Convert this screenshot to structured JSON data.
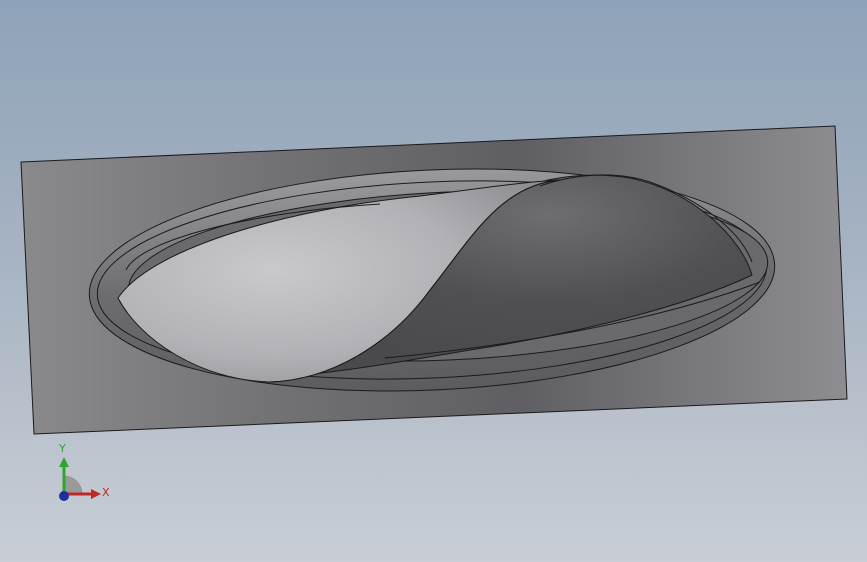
{
  "viewport": {
    "background_top": "#8ea2b9",
    "background_bottom": "#c9ced5"
  },
  "model": {
    "plate_color": "#7d7d80",
    "bump_light": "#c4c4c8",
    "bump_dark": "#4e4e52",
    "edge_color": "#1a1a1a"
  },
  "triad": {
    "x_label": "X",
    "y_label": "Y",
    "x_color": "#c0262a",
    "y_color": "#2fa52f",
    "z_color": "#1f2f9a"
  }
}
